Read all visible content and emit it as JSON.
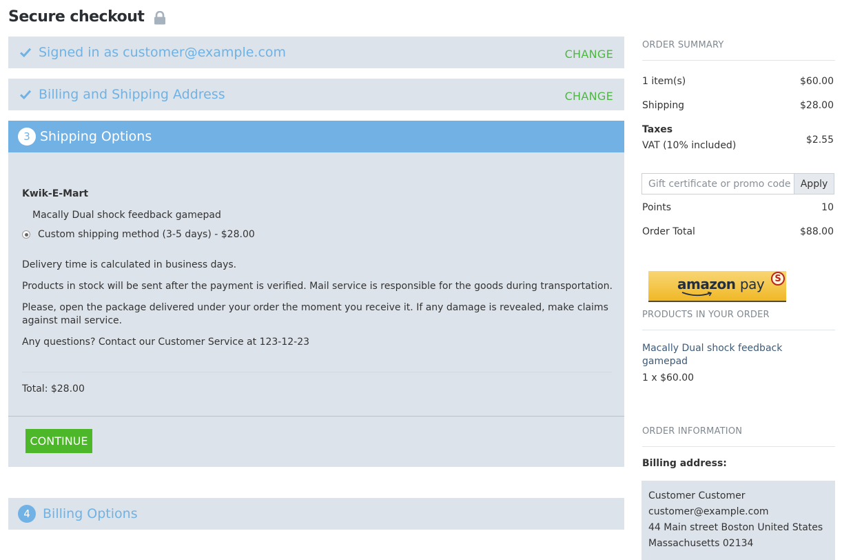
{
  "page": {
    "title": "Secure checkout"
  },
  "steps": {
    "signed_in": {
      "title": "Signed in as customer@example.com",
      "action": "CHANGE"
    },
    "address": {
      "title": "Billing and Shipping Address",
      "action": "CHANGE"
    },
    "shipping": {
      "number": "3",
      "title": "Shipping Options"
    },
    "billing": {
      "number": "4",
      "title": "Billing Options"
    }
  },
  "shipping_panel": {
    "store": "Kwik-E-Mart",
    "product": "Macally Dual shock feedback gamepad",
    "method": "Custom shipping method (3-5 days) - $28.00",
    "method_selected": true,
    "notes": [
      "Delivery time is calculated in business days.",
      "Products in stock will be sent after the payment is verified. Mail service is responsible for the goods during transportation.",
      "Please, open the package delivered under your order the moment you receive it. If any damage is revealed, make claims against mail service.",
      "Any questions? Contact our Customer Service at 123-12-23"
    ],
    "total": "Total: $28.00",
    "continue_label": "CONTINUE"
  },
  "summary": {
    "heading": "ORDER SUMMARY",
    "items_label": "1 item(s)",
    "items_value": "$60.00",
    "shipping_label": "Shipping",
    "shipping_value": "$28.00",
    "taxes_label": "Taxes",
    "vat_label": "VAT (10% included)",
    "vat_value": "$2.55",
    "promo_placeholder": "Gift certificate or promo code",
    "apply_label": "Apply",
    "points_label": "Points",
    "points_value": "10",
    "total_label": "Order Total",
    "total_value": "$88.00"
  },
  "amazon_pay": {
    "brand": "amazon",
    "suffix": "pay",
    "badge": "S"
  },
  "products": {
    "heading": "PRODUCTS IN YOUR ORDER",
    "items": [
      {
        "name": "Macally Dual shock feedback gamepad",
        "qty": "1 x $60.00"
      }
    ]
  },
  "order_info": {
    "heading": "ORDER INFORMATION",
    "billing_label": "Billing address:",
    "address_lines": [
      "Customer Customer",
      "customer@example.com",
      "44 Main street Boston United States",
      "Massachusetts 02134"
    ]
  },
  "colors": {
    "accent_blue": "#72b1e4",
    "link_blue": "#6fb2e3",
    "change_green": "#4cb83f",
    "continue_green": "#4cb829",
    "panel_bg": "#dde3eb"
  },
  "icons": {
    "title": "lock-icon",
    "completed_step": "checkmark-icon",
    "radio": "radio-selected"
  }
}
